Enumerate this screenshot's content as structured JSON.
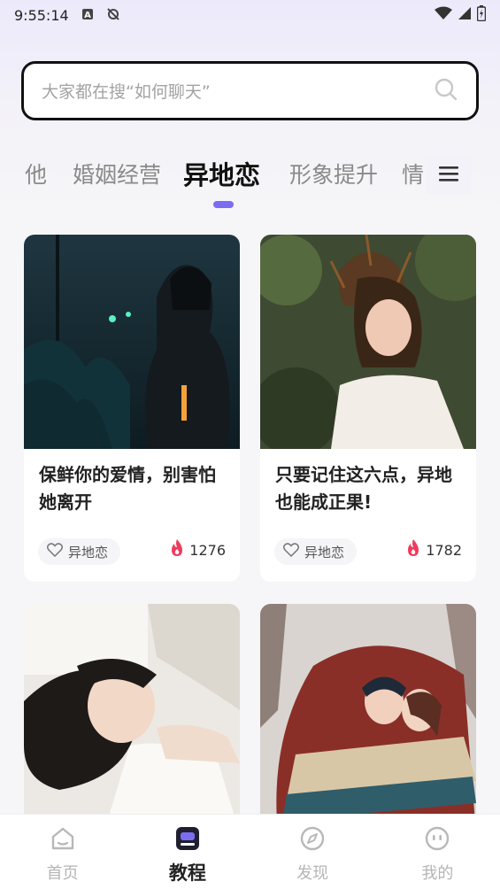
{
  "status_bar": {
    "time": "9:55:14"
  },
  "search": {
    "placeholder": "大家都在搜“如何聊天”"
  },
  "tabs": [
    {
      "label": "他"
    },
    {
      "label": "婚姻经营"
    },
    {
      "label": "异地恋",
      "active": true
    },
    {
      "label": "形象提升"
    },
    {
      "label": "情"
    }
  ],
  "cards": [
    {
      "title": "保鲜你的爱情，别害怕她离开",
      "tag": "异地恋",
      "views": "1276"
    },
    {
      "title": "只要记住这六点，异地也能成正果!",
      "tag": "异地恋",
      "views": "1782"
    },
    {
      "title": "",
      "tag": "",
      "views": ""
    },
    {
      "title": "",
      "tag": "",
      "views": ""
    }
  ],
  "nav": [
    {
      "label": "首页",
      "icon": "home-icon"
    },
    {
      "label": "教程",
      "icon": "tutorial-icon",
      "active": true
    },
    {
      "label": "发现",
      "icon": "compass-icon"
    },
    {
      "label": "我的",
      "icon": "profile-icon"
    }
  ],
  "colors": {
    "accent": "#7b6cf2",
    "hot": "#f03a5f"
  }
}
